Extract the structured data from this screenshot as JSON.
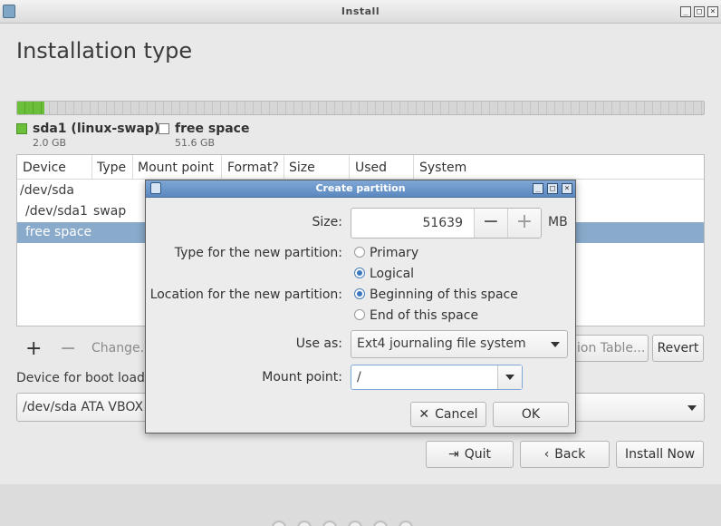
{
  "window": {
    "title": "Install",
    "min_glyph": "_",
    "max_glyph": "□",
    "close_glyph": "×"
  },
  "page": {
    "title": "Installation type"
  },
  "partition_bar": {
    "swap_fraction": 0.039,
    "swap_color": "#6bbf3a",
    "free_color": "#d6d6d6"
  },
  "legend": [
    {
      "name": "sda1 (linux-swap)",
      "size": "2.0 GB",
      "color": "#6bbf3a"
    },
    {
      "name": "free space",
      "size": "51.6 GB",
      "color": "#ffffff"
    }
  ],
  "table": {
    "columns": [
      "Device",
      "Type",
      "Mount point",
      "Format?",
      "Size",
      "Used",
      "System"
    ],
    "rows": [
      {
        "device": "/dev/sda",
        "type": ""
      },
      {
        "device": "/dev/sda1",
        "type": "swap"
      },
      {
        "device": "free space",
        "type": "",
        "selected": true
      }
    ]
  },
  "toolbar": {
    "add": "+",
    "remove": "−",
    "change": "Change...",
    "new_table": "ion Table...",
    "revert": "Revert"
  },
  "boot": {
    "label": "Device for boot loade",
    "value": "/dev/sda ATA VBOX"
  },
  "nav": {
    "quit": "Quit",
    "back": "Back",
    "install_now": "Install Now"
  },
  "dialog": {
    "title": "Create partition",
    "size_label": "Size:",
    "size_value": "51639",
    "size_minus": "−",
    "size_plus": "+",
    "size_unit": "MB",
    "type_label": "Type for the new partition:",
    "type_primary": "Primary",
    "type_logical": "Logical",
    "type_selected": "Logical",
    "location_label": "Location for the new partition:",
    "location_beginning": "Beginning of this space",
    "location_end": "End of this space",
    "location_selected": "Beginning of this space",
    "use_as_label": "Use as:",
    "use_as_value": "Ext4 journaling file system",
    "mount_label": "Mount point:",
    "mount_value": "/",
    "cancel": "Cancel",
    "ok": "OK"
  }
}
